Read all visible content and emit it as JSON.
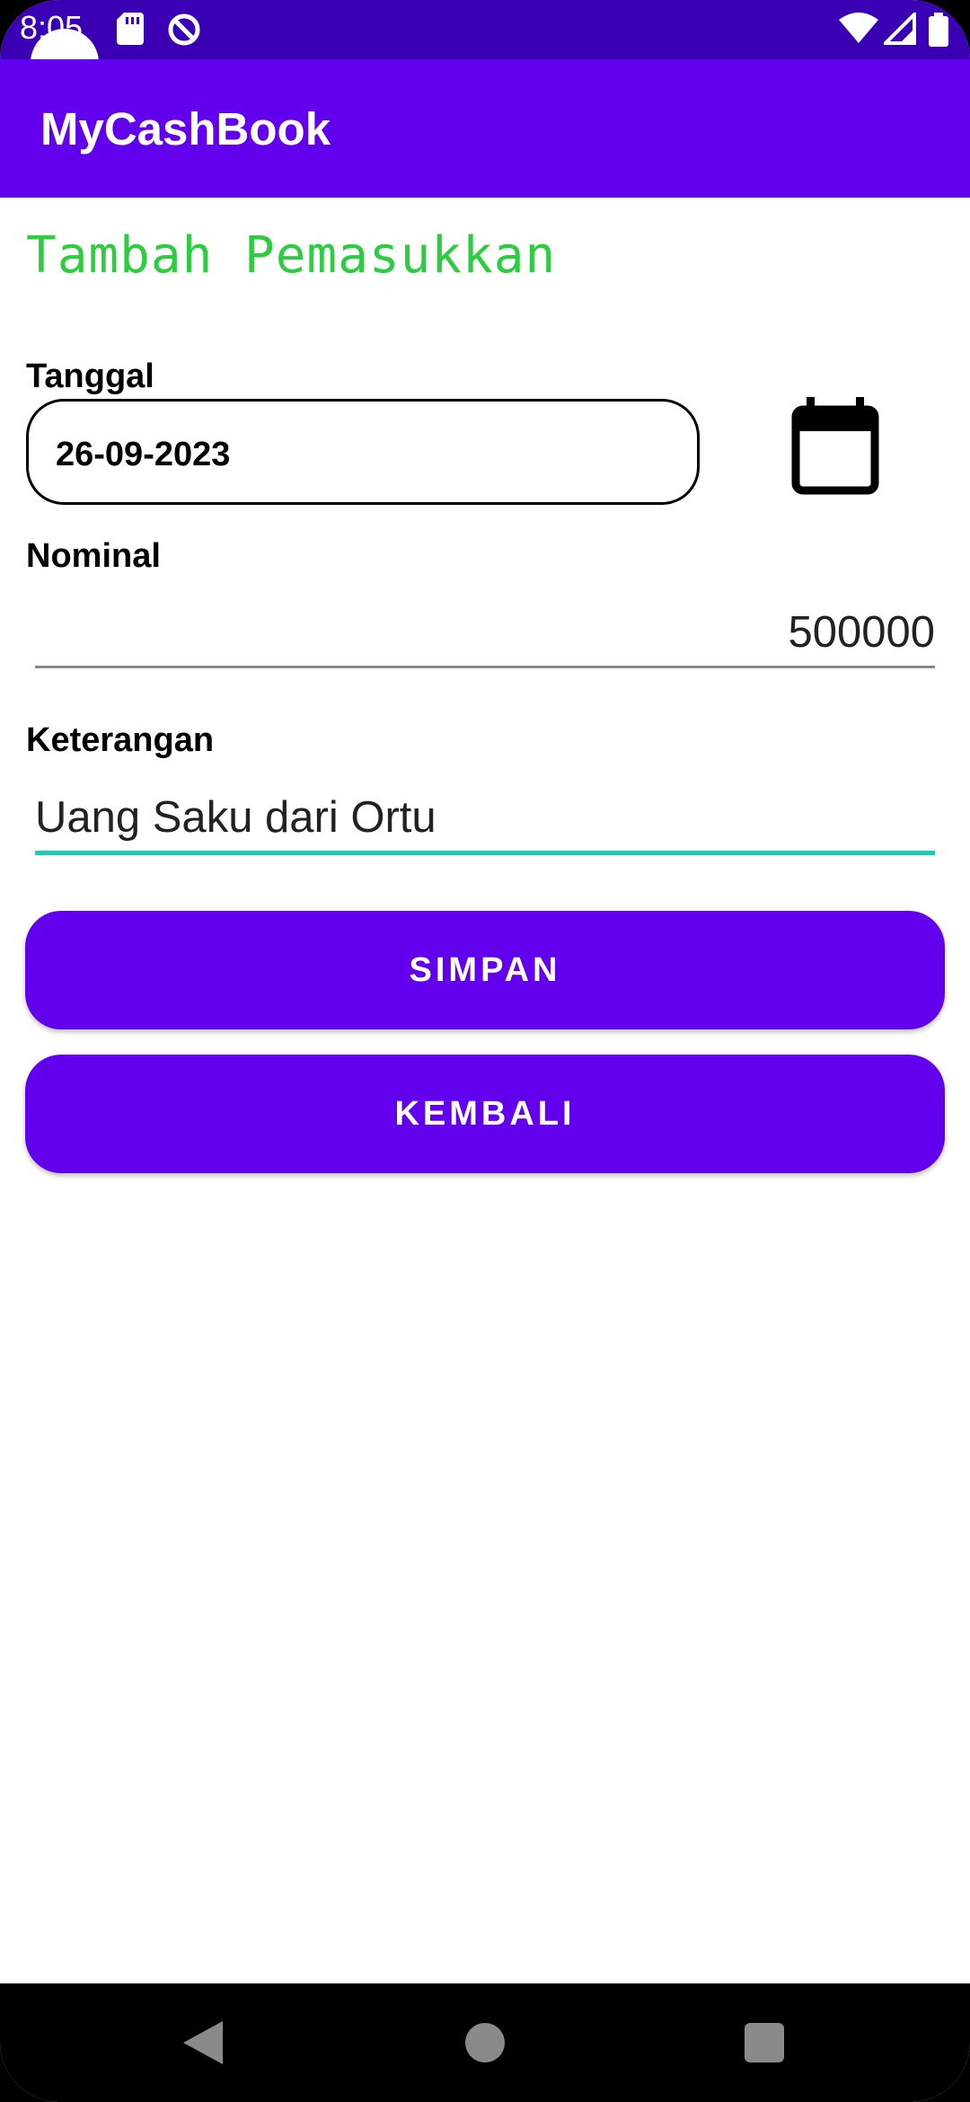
{
  "status_bar": {
    "time": "8:05",
    "icons": [
      "sd-card-icon",
      "data-saver-icon",
      "wifi-icon",
      "cell-signal-icon",
      "battery-icon"
    ]
  },
  "app_bar": {
    "title": "MyCashBook"
  },
  "page": {
    "title": "Tambah Pemasukkan"
  },
  "form": {
    "date_label": "Tanggal",
    "date_value": "26-09-2023",
    "nominal_label": "Nominal",
    "nominal_value": "500000",
    "keterangan_label": "Keterangan",
    "keterangan_value": "Uang Saku dari Ortu"
  },
  "buttons": {
    "save_label": "SIMPAN",
    "back_label": "KEMBALI"
  },
  "colors": {
    "primary": "#6200ee",
    "status_bar": "#3a00b4",
    "title_green": "#2ecc40",
    "focus_underline": "#1ecbb8"
  }
}
